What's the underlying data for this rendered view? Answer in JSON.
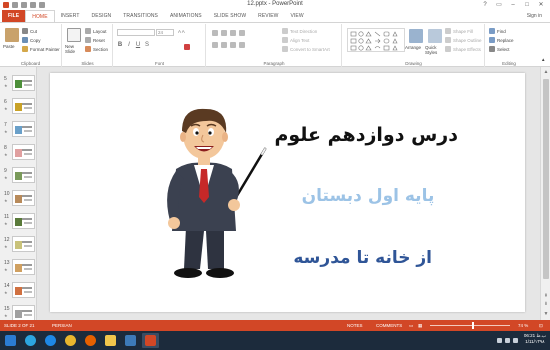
{
  "window": {
    "title": "12.pptx - PowerPoint",
    "minimize": "–",
    "maximize": "□",
    "close": "✕",
    "help": "?",
    "restore": "▭"
  },
  "tabs": [
    "FILE",
    "HOME",
    "INSERT",
    "DESIGN",
    "TRANSITIONS",
    "ANIMATIONS",
    "SLIDE SHOW",
    "REVIEW",
    "VIEW"
  ],
  "signin": "Sign in",
  "ribbon": {
    "clipboard": {
      "paste": "Paste",
      "cut": "Cut",
      "copy": "Copy",
      "format_painter": "Format Painter",
      "label": "Clipboard"
    },
    "slides": {
      "new_slide": "New Slide",
      "layout": "Layout",
      "reset": "Reset",
      "section": "Section",
      "label": "Slides"
    },
    "font": {
      "font_size": "24",
      "bold": "B",
      "italic": "I",
      "underline": "U",
      "strike": "S",
      "label": "Font"
    },
    "paragraph": {
      "text_direction": "Text Direction",
      "align_text": "Align Text",
      "smartart": "Convert to SmartArt",
      "label": "Paragraph"
    },
    "drawing": {
      "arrange": "Arrange",
      "quick_styles": "Quick Styles",
      "shape_fill": "Shape Fill",
      "shape_outline": "Shape Outline",
      "shape_effects": "Shape Effects",
      "label": "Drawing"
    },
    "editing": {
      "find": "Find",
      "replace": "Replace",
      "select": "Select",
      "label": "Editing"
    }
  },
  "thumbnails": [
    {
      "num": "5",
      "color": "#4d8f3a"
    },
    {
      "num": "6",
      "color": "#c9a227"
    },
    {
      "num": "7",
      "color": "#6aa0c9"
    },
    {
      "num": "8",
      "color": "#e0a0a0"
    },
    {
      "num": "9",
      "color": "#7a9a5a"
    },
    {
      "num": "10",
      "color": "#b88a5a"
    },
    {
      "num": "11",
      "color": "#5a7a3a"
    },
    {
      "num": "12",
      "color": "#c9c27a"
    },
    {
      "num": "13",
      "color": "#d0a060"
    },
    {
      "num": "14",
      "color": "#d07040"
    },
    {
      "num": "15",
      "color": "#a0a0a0"
    }
  ],
  "slide": {
    "title": "درس دوازدهم علوم",
    "subtitle": "پایه اول دبستان",
    "lesson": "از خانه تا مدرسه"
  },
  "status": {
    "slide_info": "SLIDE 2 OF 21",
    "language": "PERSIAN",
    "notes": "NOTES",
    "comments": "COMMENTS",
    "zoom": "74 %"
  },
  "taskbar": {
    "time": "06:21 ب.ظ",
    "date": "1/11/۱۳۹۸",
    "apps": [
      {
        "name": "start",
        "color": "#2b7cd3"
      },
      {
        "name": "telegram",
        "color": "#2ca5e0"
      },
      {
        "name": "ie",
        "color": "#1e88e5"
      },
      {
        "name": "chrome",
        "color": "#e8b62e"
      },
      {
        "name": "firefox",
        "color": "#e66000"
      },
      {
        "name": "explorer",
        "color": "#f2c64c"
      },
      {
        "name": "media",
        "color": "#3d7ab8"
      },
      {
        "name": "powerpoint",
        "color": "#d24726"
      }
    ]
  }
}
